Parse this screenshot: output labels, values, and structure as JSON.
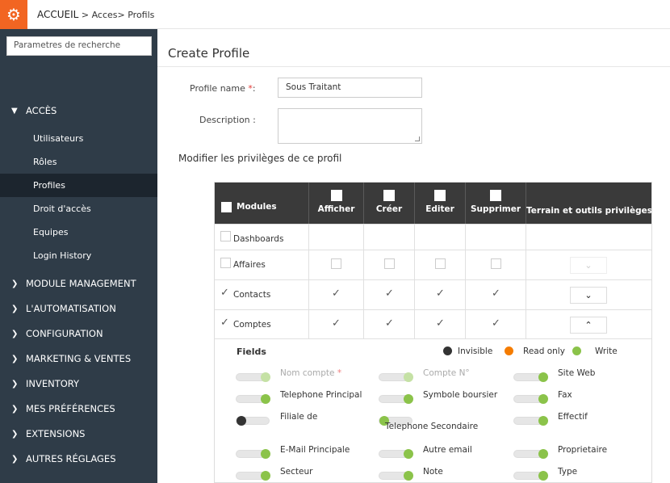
{
  "breadcrumb": {
    "home": "ACCUEIL",
    "sep1": ">",
    "acces": "Acces",
    "sep2": ">",
    "current": "Profils"
  },
  "sidebar": {
    "search_placeholder": "Parametres de recherche",
    "section_open": "ACCÈS",
    "sub_items": [
      "Utilisateurs",
      "Rôles",
      "Profiles",
      "Droit d'accès",
      "Equipes",
      "Login History"
    ],
    "active_sub": "Profiles",
    "sections": [
      "MODULE MANAGEMENT",
      "L'AUTOMATISATION",
      "CONFIGURATION",
      "MARKETING & VENTES",
      "INVENTORY",
      "MES PRÉFÉRENCES",
      "EXTENSIONS",
      "AUTRES RÉGLAGES"
    ]
  },
  "page": {
    "title": "Create Profile",
    "profile_name_label": "Profile name",
    "required_mark": "*",
    "colon": ":",
    "profile_name_value": "Sous Traitant",
    "description_label": "Description :",
    "description_value": "",
    "privileges_heading": "Modifier les privilèges de ce profil"
  },
  "table": {
    "headers": [
      "Modules",
      "Afficher",
      "Créer",
      "Editer",
      "Supprimer",
      "Terrain et outils privilèges"
    ],
    "rows": [
      {
        "module": "Dashboards",
        "checked": false,
        "perms": null,
        "dropdown": null
      },
      {
        "module": "Affaires",
        "checked": false,
        "perms": [
          false,
          false,
          false,
          false
        ],
        "dropdown": "disabled"
      },
      {
        "module": "Contacts",
        "checked": true,
        "perms": [
          true,
          true,
          true,
          true
        ],
        "dropdown": "down"
      },
      {
        "module": "Comptes",
        "checked": true,
        "perms": [
          true,
          true,
          true,
          true
        ],
        "dropdown": "up"
      }
    ]
  },
  "fields": {
    "title": "Fields",
    "legend": [
      {
        "label": "Invisible",
        "color": "#333333"
      },
      {
        "label": "Read only",
        "color": "#f57c00"
      },
      {
        "label": "Write",
        "color": "#8bc34a"
      }
    ],
    "items": [
      {
        "name": "Nom compte",
        "required": true,
        "state": "disabled"
      },
      {
        "name": "Compte N°",
        "required": false,
        "state": "disabled"
      },
      {
        "name": "Site Web",
        "required": false,
        "state": "write"
      },
      {
        "name": "Telephone Principal",
        "required": false,
        "state": "write"
      },
      {
        "name": "Symbole boursier",
        "required": false,
        "state": "write"
      },
      {
        "name": "Fax",
        "required": false,
        "state": "write"
      },
      {
        "name": "Filiale de",
        "required": false,
        "state": "invisible"
      },
      {
        "name": "Telephone Secondaire",
        "required": false,
        "state": "write"
      },
      {
        "name": "Effectif",
        "required": false,
        "state": "write"
      },
      {
        "name": "E-Mail Principale",
        "required": false,
        "state": "write"
      },
      {
        "name": "Autre email",
        "required": false,
        "state": "write"
      },
      {
        "name": "Proprietaire",
        "required": false,
        "state": "write"
      },
      {
        "name": "Secteur",
        "required": false,
        "state": "write"
      },
      {
        "name": "Note",
        "required": false,
        "state": "write"
      },
      {
        "name": "Type",
        "required": false,
        "state": "write"
      }
    ]
  },
  "colors": {
    "brand": "#f26522",
    "sidebar": "#2f3c48",
    "sidebar_active": "#1c252e",
    "header": "#3a3a3a",
    "write": "#8bc34a",
    "write_muted": "#c5e1a5",
    "invisible": "#333333"
  }
}
